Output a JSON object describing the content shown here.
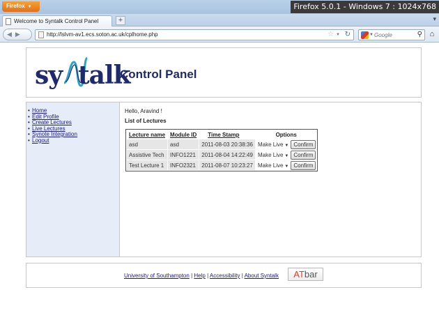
{
  "browser": {
    "menu_button": "Firefox",
    "window_caption": "Firefox 5.0.1 - Windows 7 : 1024x768",
    "tab_title": "Welcome to Syntalk Control Panel",
    "new_tab": "+",
    "url": "http://lslvm-av1.ecs.soton.ac.uk/cplhome.php",
    "search_placeholder": "Google"
  },
  "header": {
    "logo_sy": "sy",
    "logo_talk": "talk",
    "title": "Control Panel"
  },
  "sidebar": {
    "items": [
      {
        "label": "Home"
      },
      {
        "label": "Edit Profile"
      },
      {
        "label": "Create Lectures"
      },
      {
        "label": "Live Lectures"
      },
      {
        "label": "Synote Integration"
      },
      {
        "label": "Logout"
      }
    ]
  },
  "main": {
    "greeting": "Hello, Aravind !",
    "list_title": "List of Lectures",
    "columns": [
      "Lecture name",
      "Module ID",
      "Time Stamp",
      "Options"
    ],
    "rows": [
      {
        "name": "asd",
        "module": "asd",
        "timestamp": "2011-08-03 20:38:36",
        "option": "Make Live",
        "button": "Confirm"
      },
      {
        "name": "Assistive Tech",
        "module": "INFO1221",
        "timestamp": "2011-08-04 14:22:49",
        "option": "Make Live",
        "button": "Confirm"
      },
      {
        "name": "Test Lecture 1",
        "module": "INFO2321",
        "timestamp": "2011-08-07 10:23:27",
        "option": "Make Live",
        "button": "Confirm"
      }
    ]
  },
  "footer": {
    "links": [
      "University of Southampton",
      "Help",
      "Accessibility",
      "About Syntalk"
    ],
    "separator": "|",
    "atbar_at": "AT",
    "atbar_bar": "bar"
  }
}
